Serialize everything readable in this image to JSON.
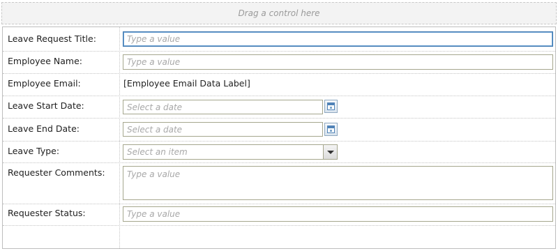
{
  "drop_zone": {
    "text": "Drag a control here"
  },
  "form": {
    "leave_request_title": {
      "label": "Leave Request Title:",
      "placeholder": "Type a value"
    },
    "employee_name": {
      "label": "Employee Name:",
      "placeholder": "Type a value"
    },
    "employee_email": {
      "label": "Employee Email:",
      "value": "[Employee Email Data Label]"
    },
    "leave_start_date": {
      "label": "Leave Start Date:",
      "placeholder": "Select a date",
      "icon": "calendar-icon"
    },
    "leave_end_date": {
      "label": "Leave End Date:",
      "placeholder": "Select a date",
      "icon": "calendar-icon"
    },
    "leave_type": {
      "label": "Leave Type:",
      "placeholder": "Select an item",
      "icon": "chevron-down-icon"
    },
    "requester_comments": {
      "label": "Requester Comments:",
      "placeholder": "Type a value"
    },
    "requester_status": {
      "label": "Requester Status:",
      "placeholder": "Type a value"
    }
  },
  "colors": {
    "focus_border": "#3f78b0",
    "field_border": "#a5a68d",
    "placeholder": "#a8a8a8",
    "calendar_accent": "#4f82b7"
  }
}
